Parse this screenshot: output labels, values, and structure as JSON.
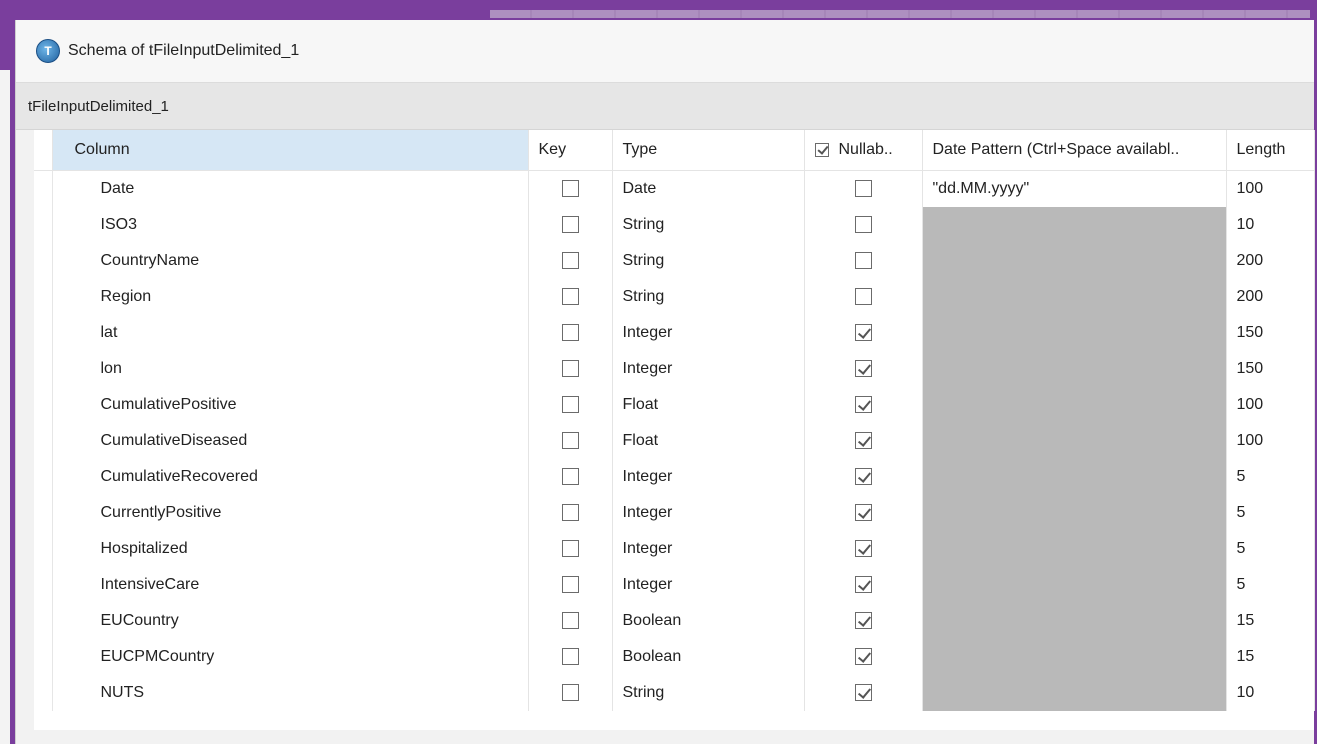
{
  "window": {
    "title": "Schema of tFileInputDelimited_1",
    "subtitle": "tFileInputDelimited_1"
  },
  "table": {
    "headers": {
      "column": "Column",
      "key": "Key",
      "type": "Type",
      "nullable": "Nullab..",
      "date_pattern": "Date Pattern (Ctrl+Space availabl..",
      "length": "Length"
    },
    "rows": [
      {
        "column": "Date",
        "key": false,
        "type": "Date",
        "nullable": false,
        "date_pattern": "\"dd.MM.yyyy\"",
        "length": "100"
      },
      {
        "column": "ISO3",
        "key": false,
        "type": "String",
        "nullable": false,
        "date_pattern": "",
        "length": "10"
      },
      {
        "column": "CountryName",
        "key": false,
        "type": "String",
        "nullable": false,
        "date_pattern": "",
        "length": "200"
      },
      {
        "column": "Region",
        "key": false,
        "type": "String",
        "nullable": false,
        "date_pattern": "",
        "length": "200"
      },
      {
        "column": "lat",
        "key": false,
        "type": "Integer",
        "nullable": true,
        "date_pattern": "",
        "length": "150"
      },
      {
        "column": "lon",
        "key": false,
        "type": "Integer",
        "nullable": true,
        "date_pattern": "",
        "length": "150"
      },
      {
        "column": "CumulativePositive",
        "key": false,
        "type": "Float",
        "nullable": true,
        "date_pattern": "",
        "length": "100"
      },
      {
        "column": "CumulativeDiseased",
        "key": false,
        "type": "Float",
        "nullable": true,
        "date_pattern": "",
        "length": "100"
      },
      {
        "column": "CumulativeRecovered",
        "key": false,
        "type": "Integer",
        "nullable": true,
        "date_pattern": "",
        "length": "5"
      },
      {
        "column": "CurrentlyPositive",
        "key": false,
        "type": "Integer",
        "nullable": true,
        "date_pattern": "",
        "length": "5"
      },
      {
        "column": "Hospitalized",
        "key": false,
        "type": "Integer",
        "nullable": true,
        "date_pattern": "",
        "length": "5"
      },
      {
        "column": "IntensiveCare",
        "key": false,
        "type": "Integer",
        "nullable": true,
        "date_pattern": "",
        "length": "5"
      },
      {
        "column": "EUCountry",
        "key": false,
        "type": "Boolean",
        "nullable": true,
        "date_pattern": "",
        "length": "15"
      },
      {
        "column": "EUCPMCountry",
        "key": false,
        "type": "Boolean",
        "nullable": true,
        "date_pattern": "",
        "length": "15"
      },
      {
        "column": "NUTS",
        "key": false,
        "type": "String",
        "nullable": true,
        "date_pattern": "",
        "length": "10"
      }
    ]
  }
}
